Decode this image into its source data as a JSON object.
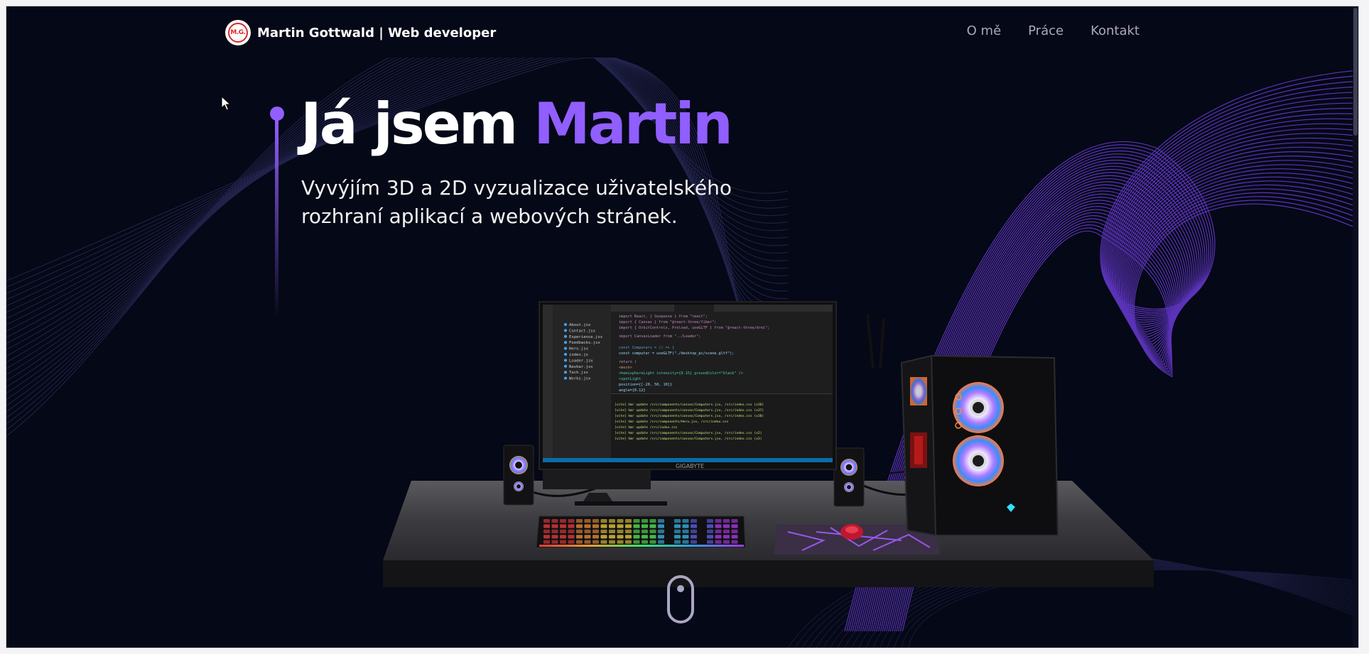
{
  "header": {
    "logo_text": "M.G.",
    "brand": "Martin Gottwald | Web developer",
    "nav": [
      {
        "label": "O mě"
      },
      {
        "label": "Práce"
      },
      {
        "label": "Kontakt"
      }
    ]
  },
  "hero": {
    "title_prefix": "Já jsem",
    "title_name": "Martin",
    "subtitle_line1": "Vyvýjím 3D a 2D vyzualizace uživatelského",
    "subtitle_line2": "rozhraní aplikací a webových stránek."
  },
  "scene": {
    "monitor_brand": "GIGABYTE",
    "editor_files": [
      "About.jsx",
      "Contact.jsx",
      "Experience.jsx",
      "Feedbacks.jsx",
      "Hero.jsx",
      "index.js",
      "Loader.jsx",
      "Navbar.jsx",
      "Tech.jsx",
      "Works.jsx"
    ],
    "code_lines": [
      "import React, { Suspense } from \"react\";",
      "import { Canvas } from \"@react-three/fiber\";",
      "import { OrbitControls, Preload, useGLTF } from \"@react-three/drei\";",
      "import CanvasLoader from \"../Loader\";",
      "const Computers = () => {",
      "  const computer = useGLTF(\"./desktop_pc/scene.gltf\");",
      "  return (",
      "    <mesh>",
      "      <hemisphereLight intensity={0.15} groundColor=\"black\" />",
      "      <spotLight",
      "        position={[-20, 50, 10]}",
      "        angle={0.12}",
      "        penumbra={1}"
    ],
    "terminal_lines": [
      "[vite] hmr update /src/components/canvas/Computers.jsx, /src/index.css (x36)",
      "[vite] hmr update /src/components/canvas/Computers.jsx, /src/index.css (x37)",
      "[vite] hmr update /src/components/canvas/Computers.jsx, /src/index.css (x38)",
      "[vite] hmr update /src/components/Hero.jsx, /src/index.css",
      "[vite] hmr update /src/index.css",
      "[vite] hmr update /src/components/canvas/Computers.jsx, /src/index.css (x2)",
      "[vite] hmr update /src/components/canvas/Computers.jsx, /src/index.css (x3)"
    ]
  },
  "colors": {
    "background": "#050816",
    "accent": "#915eff",
    "nav_text": "#aaa6c3",
    "white": "#ffffff"
  }
}
